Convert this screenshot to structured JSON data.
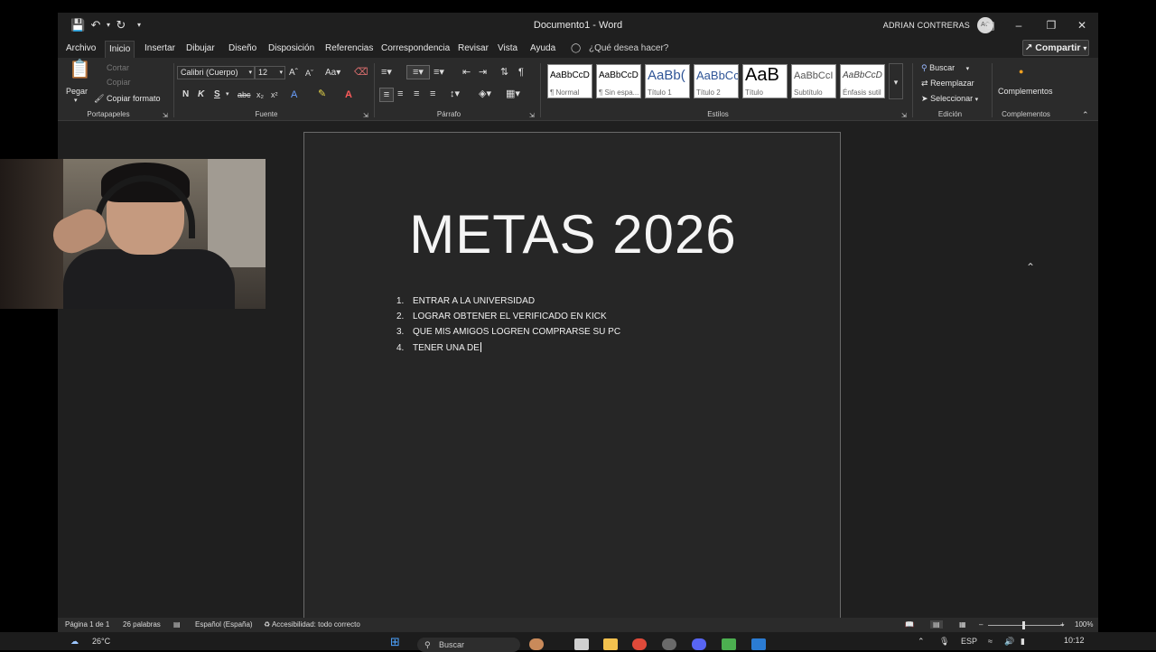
{
  "window": {
    "title": "Documento1 - Word",
    "user_name": "ADRIAN CONTRERAS",
    "user_initials": "AC"
  },
  "menu": {
    "tabs": [
      "Archivo",
      "Inicio",
      "Insertar",
      "Dibujar",
      "Diseño",
      "Disposición",
      "Referencias",
      "Correspondencia",
      "Revisar",
      "Vista",
      "Ayuda"
    ],
    "active_tab": "Inicio",
    "tell_me": "¿Qué desea hacer?",
    "share": "Compartir"
  },
  "ribbon": {
    "clipboard": {
      "label": "Portapapeles",
      "paste": "Pegar",
      "cut": "Cortar",
      "copy": "Copiar",
      "format_painter": "Copiar formato"
    },
    "font": {
      "label": "Fuente",
      "font_name": "Calibri (Cuerpo)",
      "font_size": "12",
      "bold": "N",
      "italic": "K",
      "underline": "S"
    },
    "paragraph": {
      "label": "Párrafo"
    },
    "styles": {
      "label": "Estilos",
      "items": [
        {
          "sample": "AaBbCcD",
          "name": "¶ Normal"
        },
        {
          "sample": "AaBbCcD",
          "name": "¶ Sin espa..."
        },
        {
          "sample": "AaBb(",
          "name": "Título 1"
        },
        {
          "sample": "AaBbCc",
          "name": "Título 2"
        },
        {
          "sample": "AaB",
          "name": "Título"
        },
        {
          "sample": "AaBbCcI",
          "name": "Subtítulo"
        },
        {
          "sample": "AaBbCcD",
          "name": "Énfasis sutil"
        }
      ]
    },
    "editing": {
      "label": "Edición",
      "find": "Buscar",
      "replace": "Reemplazar",
      "select": "Seleccionar"
    },
    "addins": {
      "label": "Complementos",
      "button": "Complementos"
    }
  },
  "document": {
    "heading": "METAS 2026",
    "list": [
      {
        "num": "1.",
        "text": "ENTRAR A LA UNIVERSIDAD"
      },
      {
        "num": "2.",
        "text": "LOGRAR OBTENER EL VERIFICADO EN KICK"
      },
      {
        "num": "3.",
        "text": "QUE MIS AMIGOS LOGREN COMPRARSE SU PC"
      },
      {
        "num": "4.",
        "text": "TENER UNA DE"
      }
    ]
  },
  "status": {
    "page": "Página 1 de 1",
    "words": "26 palabras",
    "language": "Español (España)",
    "accessibility": "Accesibilidad: todo correcto",
    "zoom": "100%",
    "zoom_level": 1.0
  },
  "taskbar": {
    "weather": "26°C",
    "search": "Buscar",
    "lang": "ESP",
    "time": "10:12"
  },
  "colors": {
    "background": "#1f1f1f",
    "ribbon": "#2b2b2b",
    "page": "#262626"
  }
}
